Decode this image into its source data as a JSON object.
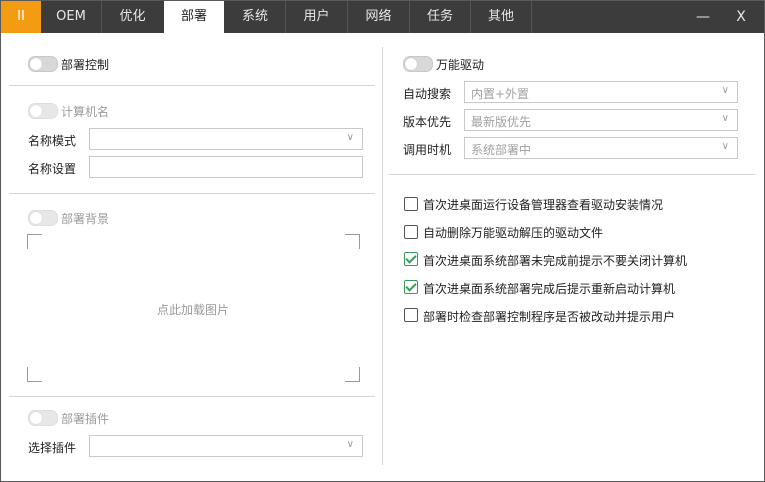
{
  "titlebar": {
    "logo": "II",
    "tabs": [
      "OEM",
      "优化",
      "部署",
      "系统",
      "用户",
      "网络",
      "任务",
      "其他"
    ],
    "minimize": "—",
    "close": "X"
  },
  "left": {
    "deploy_control": "部署控制",
    "computer_name": "计算机名",
    "name_mode_label": "名称模式",
    "name_mode_value": "",
    "name_setting_label": "名称设置",
    "name_setting_value": "",
    "deploy_background": "部署背景",
    "load_image": "点此加载图片",
    "deploy_plugin": "部署插件",
    "select_plugin_label": "选择插件",
    "select_plugin_value": ""
  },
  "right": {
    "universal_driver": "万能驱动",
    "auto_search_label": "自动搜索",
    "auto_search_value": "内置+外置",
    "version_priority_label": "版本优先",
    "version_priority_value": "最新版优先",
    "call_timing_label": "调用时机",
    "call_timing_value": "系统部署中",
    "checkboxes": [
      {
        "label": "首次进桌面运行设备管理器查看驱动安装情况",
        "checked": false
      },
      {
        "label": "自动删除万能驱动解压的驱动文件",
        "checked": false
      },
      {
        "label": "首次进桌面系统部署未完成前提示不要关闭计算机",
        "checked": true
      },
      {
        "label": "首次进桌面系统部署完成后提示重新启动计算机",
        "checked": true
      },
      {
        "label": "部署时检查部署控制程序是否被改动并提示用户",
        "checked": false
      }
    ]
  },
  "icons": {
    "chevron": "chevron-down-icon",
    "check": "check-icon"
  }
}
